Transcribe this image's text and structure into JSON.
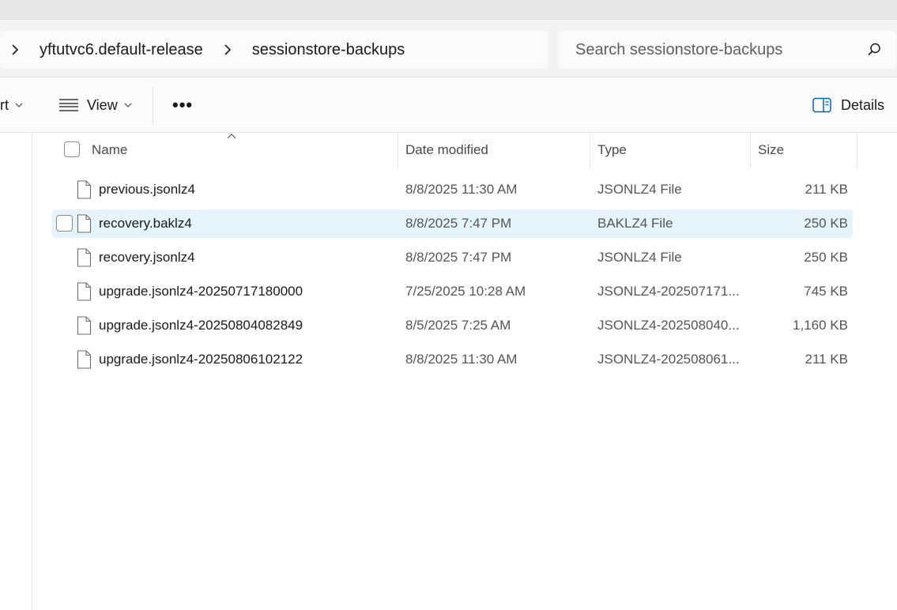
{
  "address": {
    "crumbs": [
      "yftutvc6.default-release",
      "sessionstore-backups"
    ]
  },
  "search": {
    "placeholder": "Search sessionstore-backups"
  },
  "toolbar": {
    "sort_label": "rt",
    "view_label": "View",
    "more_label": "•••",
    "details_label": "Details"
  },
  "columns": {
    "name": "Name",
    "date": "Date modified",
    "type": "Type",
    "size": "Size"
  },
  "files": [
    {
      "name": "previous.jsonlz4",
      "date": "8/8/2025 11:30 AM",
      "type": "JSONLZ4 File",
      "size": "211 KB",
      "selected": false
    },
    {
      "name": "recovery.baklz4",
      "date": "8/8/2025 7:47 PM",
      "type": "BAKLZ4 File",
      "size": "250 KB",
      "selected": true
    },
    {
      "name": "recovery.jsonlz4",
      "date": "8/8/2025 7:47 PM",
      "type": "JSONLZ4 File",
      "size": "250 KB",
      "selected": false
    },
    {
      "name": "upgrade.jsonlz4-20250717180000",
      "date": "7/25/2025 10:28 AM",
      "type": "JSONLZ4-202507171...",
      "size": "745 KB",
      "selected": false
    },
    {
      "name": "upgrade.jsonlz4-20250804082849",
      "date": "8/5/2025 7:25 AM",
      "type": "JSONLZ4-202508040...",
      "size": "1,160 KB",
      "selected": false
    },
    {
      "name": "upgrade.jsonlz4-20250806102122",
      "date": "8/8/2025 11:30 AM",
      "type": "JSONLZ4-202508061...",
      "size": "211 KB",
      "selected": false
    }
  ],
  "icons": {
    "crumb_separator": "chevron-right-icon",
    "search": "search-icon",
    "view": "list-lines-icon",
    "details": "details-pane-icon",
    "file": "file-icon"
  },
  "colors": {
    "selection": "#e5f3fb",
    "accent": "#0067c0"
  }
}
